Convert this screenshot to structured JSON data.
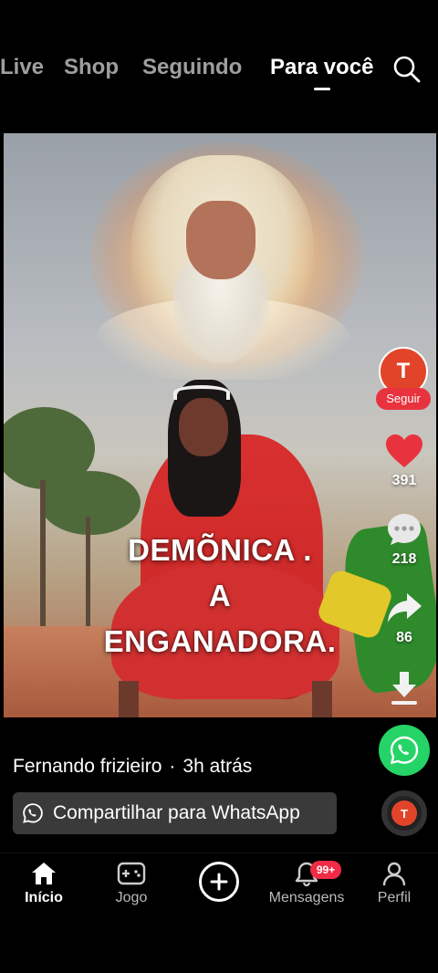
{
  "top_tabs": {
    "live": "Live",
    "shop": "Shop",
    "following": "Seguindo",
    "for_you": "Para você"
  },
  "video": {
    "caption_lines": [
      "DEMÕNICA .",
      "A",
      "ENGANADORA."
    ]
  },
  "creator": {
    "avatar_initial": "T",
    "follow_label": "Seguir",
    "name": "Fernando frizieiro",
    "separator": "·",
    "posted": "3h atrás"
  },
  "actions": {
    "likes": "391",
    "comments": "218",
    "shares": "86"
  },
  "share_whatsapp_label": "Compartilhar para WhatsApp",
  "music_disc_initial": "T",
  "bottom_nav": {
    "home": "Início",
    "game": "Jogo",
    "messages": "Mensagens",
    "messages_badge": "99+",
    "profile": "Perfil"
  },
  "colors": {
    "like": "#e8333e",
    "follow": "#e8333e",
    "whatsapp": "#25d366",
    "avatar": "#e2442a"
  }
}
